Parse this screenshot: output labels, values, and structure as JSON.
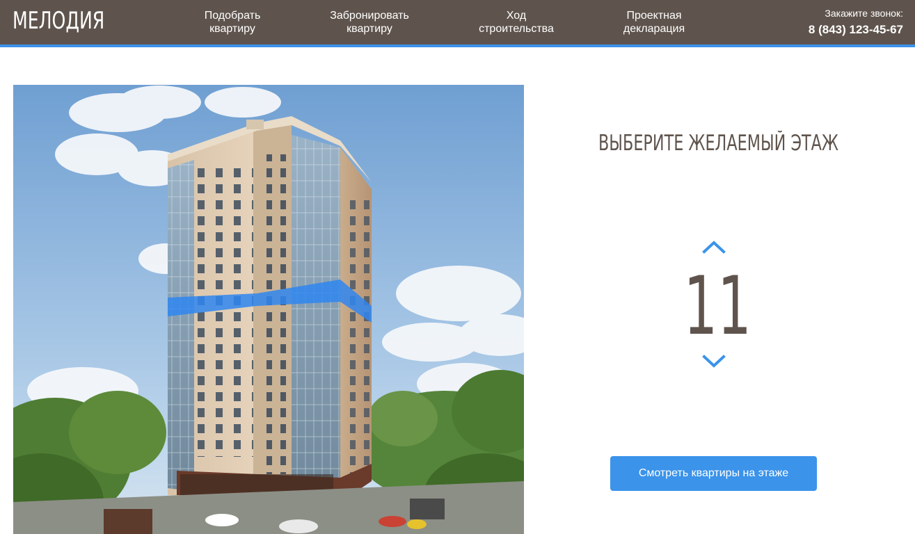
{
  "header": {
    "logo": "МЕЛОДИЯ",
    "nav": [
      {
        "line1": "Подобрать",
        "line2": "квартиру"
      },
      {
        "line1": "Забронировать",
        "line2": "квартиру"
      },
      {
        "line1": "Ход",
        "line2": "строительства"
      },
      {
        "line1": "Проектная",
        "line2": "декларация"
      }
    ],
    "callback_label": "Закажите звонок:",
    "callback_phone": "8 (843) 123-45-67"
  },
  "floor_selector": {
    "title": "ВЫБЕРИТЕ ЖЕЛАЕМЫЙ ЭТАЖ",
    "current_floor": "11",
    "up_icon": "chevron-up-icon",
    "down_icon": "chevron-down-icon",
    "button_label": "Смотреть квартиры на этаже"
  },
  "colors": {
    "header_bg": "#5f544d",
    "accent": "#3b93ea",
    "text": "#5f544d",
    "highlight": "#2f86f0"
  }
}
